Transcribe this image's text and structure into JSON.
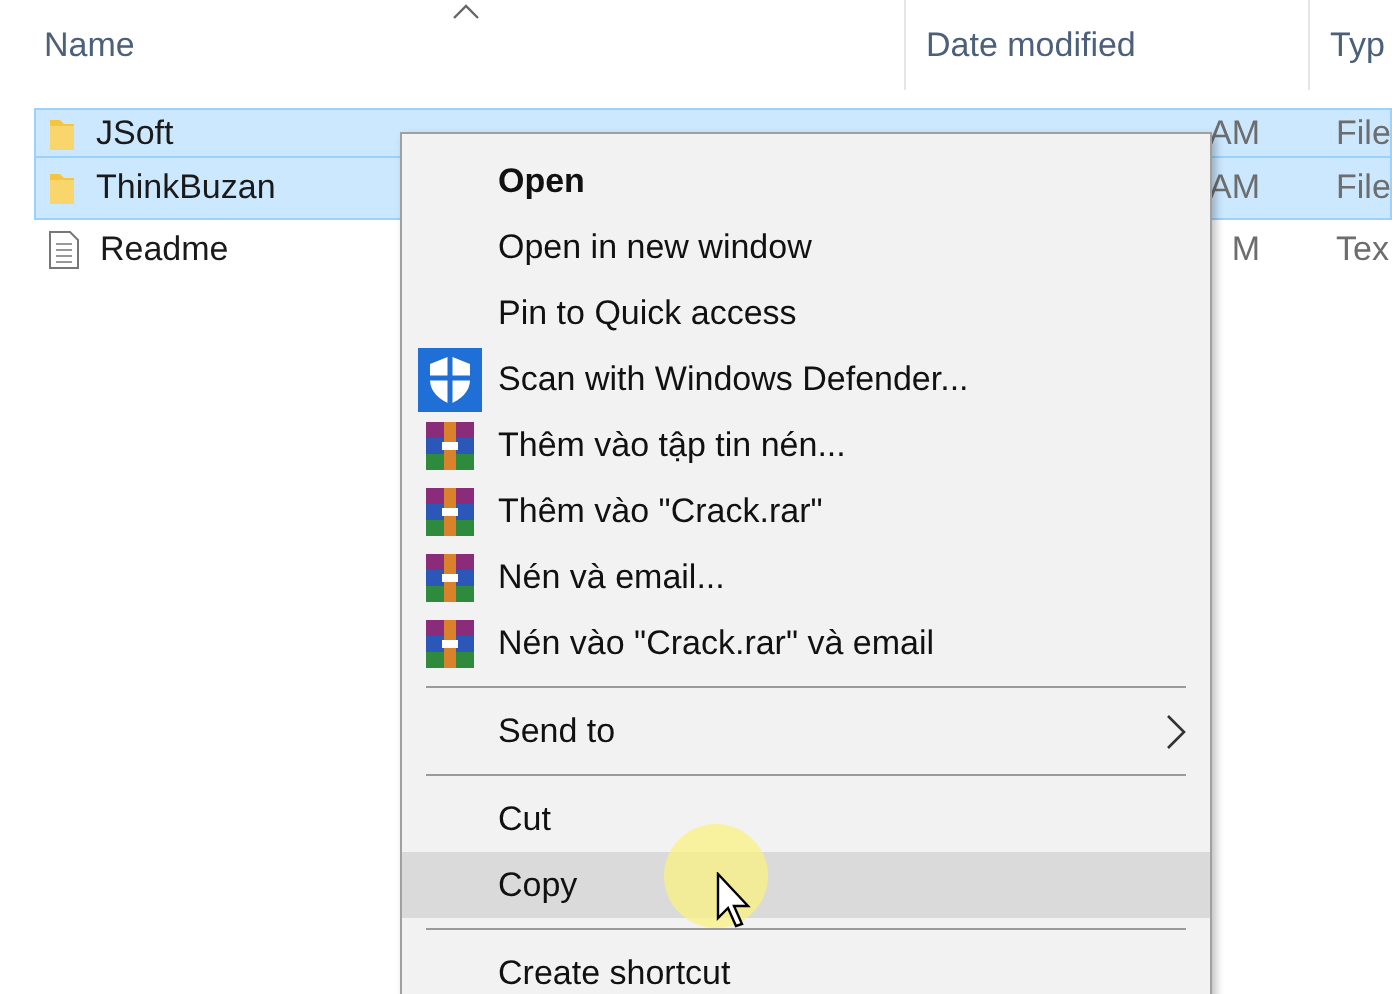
{
  "columns": [
    {
      "label": "Name",
      "sorted": true
    },
    {
      "label": "Date modified",
      "sorted": false
    },
    {
      "label": "Typ",
      "sorted": false
    }
  ],
  "rows": [
    {
      "name": "JSoft",
      "kind": "folder",
      "date": "AM",
      "type": "File",
      "selected": true
    },
    {
      "name": "ThinkBuzan",
      "kind": "folder",
      "date": "AM",
      "type": "File",
      "selected": true
    },
    {
      "name": "Readme",
      "kind": "document",
      "date": "M",
      "type": "Tex",
      "selected": false
    }
  ],
  "context_menu": {
    "items": [
      {
        "kind": "item",
        "label": "Open",
        "bold": true,
        "selected": false
      },
      {
        "kind": "item",
        "label": "Open in new window",
        "bold": false,
        "selected": false
      },
      {
        "kind": "item",
        "label": "Pin to Quick access",
        "bold": false,
        "selected": false
      },
      {
        "kind": "shield",
        "label": "Scan with Windows Defender...",
        "bold": false,
        "selected": false
      },
      {
        "kind": "archive",
        "label": "Thêm vào tập tin nén...",
        "bold": false,
        "selected": false
      },
      {
        "kind": "archive",
        "label": "Thêm vào \"Crack.rar\"",
        "bold": false,
        "selected": false
      },
      {
        "kind": "archive",
        "label": "Nén và email...",
        "bold": false,
        "selected": false
      },
      {
        "kind": "archive",
        "label": "Nén vào \"Crack.rar\" và email",
        "bold": false,
        "selected": false
      },
      {
        "kind": "separator"
      },
      {
        "kind": "submenu",
        "label": "Send to",
        "bold": false,
        "selected": false
      },
      {
        "kind": "separator"
      },
      {
        "kind": "item",
        "label": "Cut",
        "bold": false,
        "selected": false
      },
      {
        "kind": "item",
        "label": "Copy",
        "bold": false,
        "selected": true
      },
      {
        "kind": "separator"
      },
      {
        "kind": "item",
        "label": "Create shortcut",
        "bold": false,
        "selected": false
      }
    ]
  }
}
